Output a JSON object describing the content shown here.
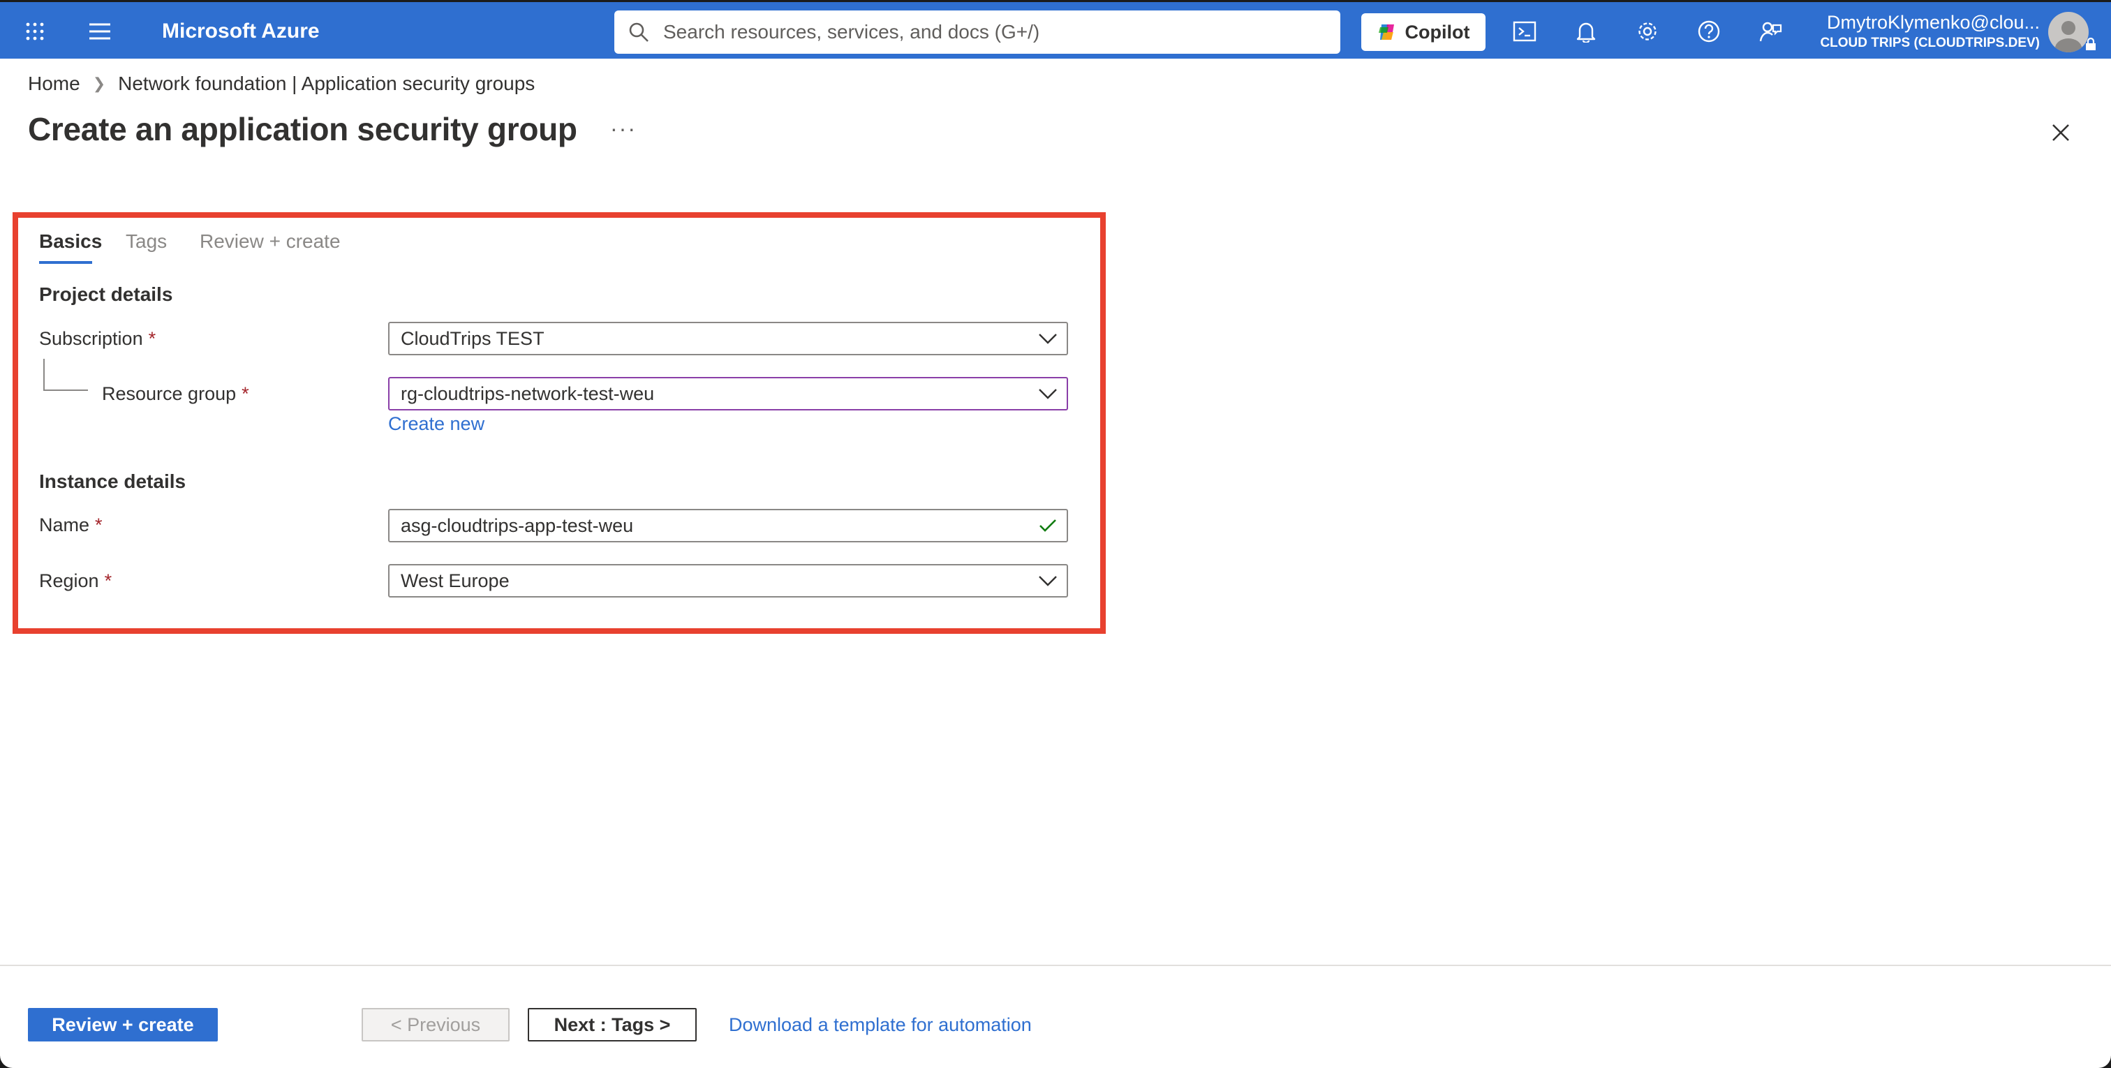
{
  "topbar": {
    "brand": "Microsoft Azure",
    "search_placeholder": "Search resources, services, and docs (G+/)",
    "copilot_label": "Copilot",
    "account_user": "DmytroKlymenko@clou...",
    "account_tenant": "CLOUD TRIPS (CLOUDTRIPS.DEV)"
  },
  "breadcrumb": [
    "Home",
    "Network foundation | Application security groups"
  ],
  "page": {
    "title": "Create an application security group",
    "more": "···"
  },
  "tabs": [
    "Basics",
    "Tags",
    "Review + create"
  ],
  "form": {
    "project_section": "Project details",
    "subscription_label": "Subscription",
    "subscription_value": "CloudTrips TEST",
    "resource_group_label": "Resource group",
    "resource_group_value": "rg-cloudtrips-network-test-weu",
    "create_new": "Create new",
    "instance_section": "Instance details",
    "name_label": "Name",
    "name_value": "asg-cloudtrips-app-test-weu",
    "region_label": "Region",
    "region_value": "West Europe",
    "required_mark": "*"
  },
  "footer": {
    "review_create": "Review + create",
    "previous": "< Previous",
    "next": "Next : Tags >",
    "download_template": "Download a template for automation"
  },
  "colors": {
    "accent": "#2f6fd0",
    "highlight_border": "#e8412f",
    "required": "#a4262c",
    "valid_check": "#107c10"
  }
}
